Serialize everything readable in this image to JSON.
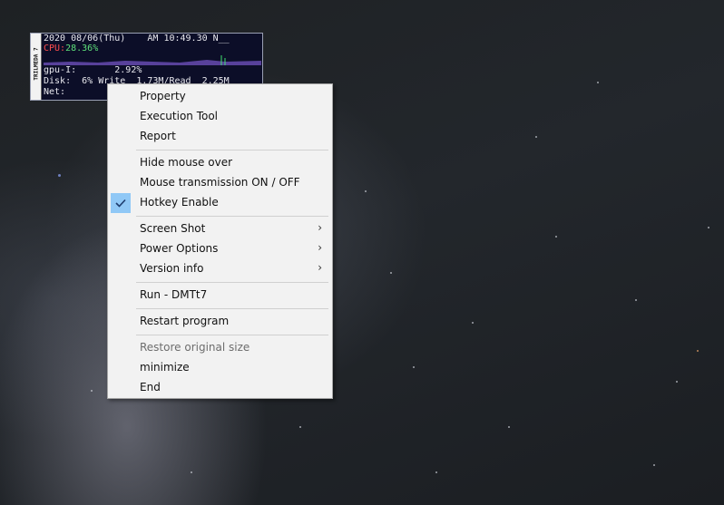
{
  "widget": {
    "brand": "TRILMEDA 7",
    "line1": "2020 08/06(Thu)    AM 10:49.30 N__",
    "cpu_label": "CPU:",
    "cpu_value": "28.36%",
    "gpu": "gpu-I:       2.92%",
    "disk": "Disk:  6% Write  1.73M/Read  2.25M",
    "net": "Net:",
    "colors": {
      "cpu_label": "#ff4d4d",
      "cpu_value": "#5ee07a",
      "background": "#0c0e28"
    }
  },
  "menu": {
    "items": [
      {
        "label": "Property"
      },
      {
        "label": "Execution Tool"
      },
      {
        "label": "Report"
      },
      {
        "label": "Hide mouse over"
      },
      {
        "label": "Mouse transmission ON / OFF"
      },
      {
        "label": "Hotkey Enable",
        "checked": true
      },
      {
        "label": "Screen Shot",
        "submenu": true
      },
      {
        "label": "Power Options",
        "submenu": true
      },
      {
        "label": "Version info",
        "submenu": true
      },
      {
        "label": "Run - DMTt7"
      },
      {
        "label": "Restart program"
      },
      {
        "label": "Restore original size",
        "disabled": true
      },
      {
        "label": "minimize"
      },
      {
        "label": "End"
      }
    ],
    "submenu_arrow": "›",
    "check_color": "#90c8f6"
  }
}
